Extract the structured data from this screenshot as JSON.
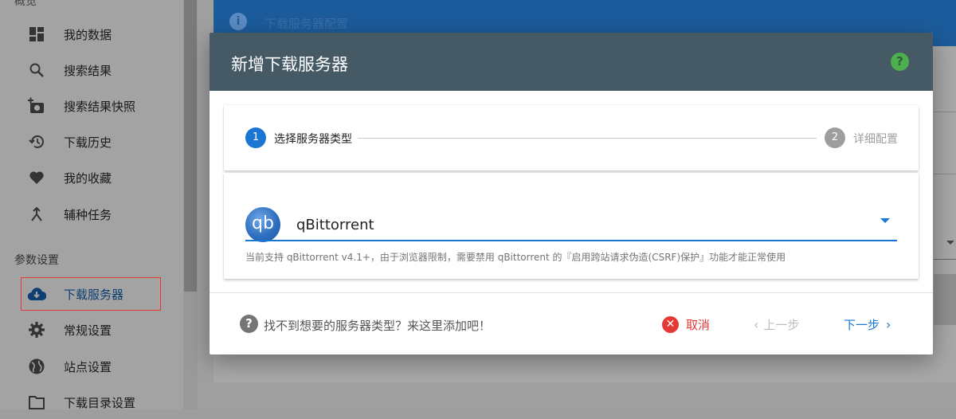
{
  "sidebar": {
    "cut_heading": "概览",
    "items": [
      {
        "label": "我的数据",
        "icon": "dashboard-icon"
      },
      {
        "label": "搜索结果",
        "icon": "search-icon"
      },
      {
        "label": "搜索结果快照",
        "icon": "camera-add-icon"
      },
      {
        "label": "下载历史",
        "icon": "history-icon"
      },
      {
        "label": "我的收藏",
        "icon": "heart-icon"
      },
      {
        "label": "辅种任务",
        "icon": "merge-icon"
      }
    ],
    "section_settings": "参数设置",
    "settings_items": [
      {
        "label": "下载服务器",
        "icon": "cloud-download-icon",
        "active": true
      },
      {
        "label": "常规设置",
        "icon": "gear-icon"
      },
      {
        "label": "站点设置",
        "icon": "globe-icon"
      },
      {
        "label": "下载目录设置",
        "icon": "folder-icon"
      }
    ]
  },
  "background_page": {
    "header_title": "下载服务器配置"
  },
  "dialog": {
    "title": "新增下载服务器",
    "stepper": {
      "steps": [
        {
          "number": "1",
          "label": "选择服务器类型",
          "active": true
        },
        {
          "number": "2",
          "label": "详细配置",
          "active": false
        }
      ]
    },
    "server_type_select": {
      "logo_text": "qb",
      "value": "qBittorrent",
      "hint": "当前支持 qBittorrent v4.1+，由于浏览器限制，需要禁用 qBittorrent 的『启用跨站请求伪造(CSRF)保护』功能才能正常使用"
    },
    "footer": {
      "help_text": "找不到想要的服务器类型？来这里添加吧！",
      "cancel_label": "取消",
      "prev_label": "上一步",
      "next_label": "下一步"
    }
  },
  "colors": {
    "accent": "#1976d2",
    "dialog_header": "#455a64",
    "help_green": "#4caf50",
    "danger": "#e53935"
  }
}
